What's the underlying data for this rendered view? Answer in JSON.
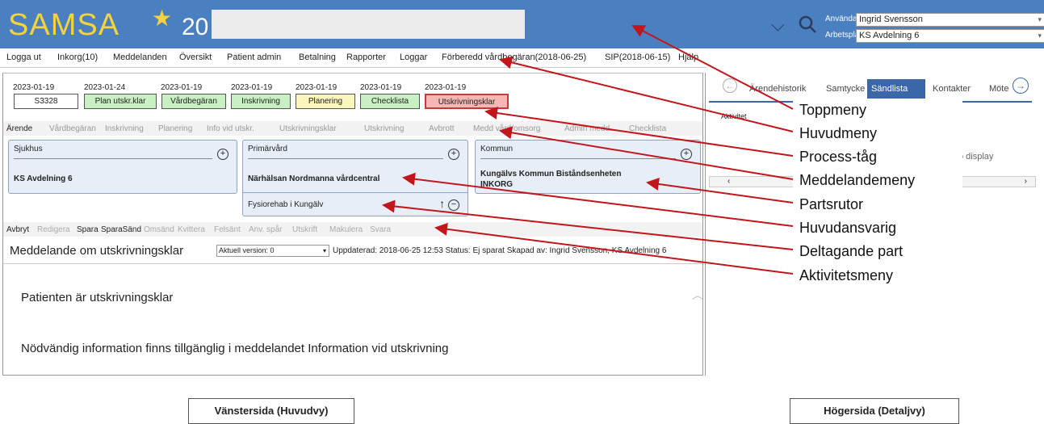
{
  "header": {
    "app_name": "SAMSA",
    "patient_prefix": "20",
    "user_label": "Användare:",
    "user_value": "Ingrid Svensson",
    "workplace_label": "Arbetsplats:",
    "workplace_value": "KS Avdelning 6"
  },
  "main_menu": [
    "Logga ut",
    "Inkorg(10)",
    "Meddelanden",
    "Översikt",
    "Patient admin",
    "Betalning",
    "Rapporter",
    "Loggar",
    "Förberedd vårdbegäran(2018-06-25)",
    "SIP(2018-06-15)",
    "Hjälp"
  ],
  "process": [
    {
      "date": "2023-01-19",
      "label": "S3328",
      "state": "id"
    },
    {
      "date": "2023-01-24",
      "label": "Plan utskr.klar",
      "state": "green"
    },
    {
      "date": "2023-01-19",
      "label": "Vårdbegäran",
      "state": "green"
    },
    {
      "date": "2023-01-19",
      "label": "Inskrivning",
      "state": "green"
    },
    {
      "date": "2023-01-19",
      "label": "Planering",
      "state": "yellow"
    },
    {
      "date": "2023-01-19",
      "label": "Checklista",
      "state": "green"
    },
    {
      "date": "2023-01-19",
      "label": "Utskrivningsklar",
      "state": "red"
    }
  ],
  "message_menu": [
    "Ärende",
    "Vårdbegäran",
    "Inskrivning",
    "Planering",
    "Info vid utskr.",
    "Utskrivningsklar",
    "Utskrivning",
    "Avbrott",
    "Medd vård/omsorg",
    "Admin medd.",
    "Checklista"
  ],
  "parties": {
    "sjukhus": {
      "title": "Sjukhus",
      "name": "KS Avdelning 6"
    },
    "primarvard": {
      "title": "Primärvård",
      "name": "Närhälsan Nordmanna vårdcentral",
      "participant": "Fysiorehab i Kungälv"
    },
    "kommun": {
      "title": "Kommun",
      "name_line1": "Kungälvs Kommun Biståndsenheten",
      "name_line2": "INKORG"
    }
  },
  "activity_menu": [
    "Avbryt",
    "Redigera",
    "Spara",
    "SparaSänd",
    "Omsänd",
    "Kvittera",
    "Felsänt",
    "Anv. spår",
    "Utskrift",
    "Makulera",
    "Svara"
  ],
  "message": {
    "title": "Meddelande om utskrivningsklar",
    "version": "Aktuell version: 0",
    "info": "Uppdaterad: 2018-06-25 12:53 Status: Ej sparat Skapad av: Ingrid Svensson, KS Avdelning 6",
    "line1": "Patienten är utskrivningsklar",
    "line2": "Nödvändig information finns tillgänglig i meddelandet Information vid utskrivning"
  },
  "right_panel": {
    "tabs": [
      "Ärendehistorik",
      "Samtycke",
      "Sändlista",
      "Kontakter",
      "Möte"
    ],
    "section": "Aktivitet",
    "empty_text": "o display"
  },
  "annotations": [
    "Toppmeny",
    "Huvudmeny",
    "Process-tåg",
    "Meddelandemeny",
    "Partsrutor",
    "Huvudansvarig",
    "Deltagande part",
    "Aktivitetsmeny"
  ],
  "captions": {
    "left": "Vänstersida (Huvudvy)",
    "right": "Högersida (Detaljvy)"
  },
  "colors": {
    "header": "#4a7fc0",
    "logo": "#f6d23b",
    "green": "#c9f0c2",
    "yellow": "#fbf6bd",
    "red": "#f4b7b3",
    "arrow": "#c0161c"
  }
}
